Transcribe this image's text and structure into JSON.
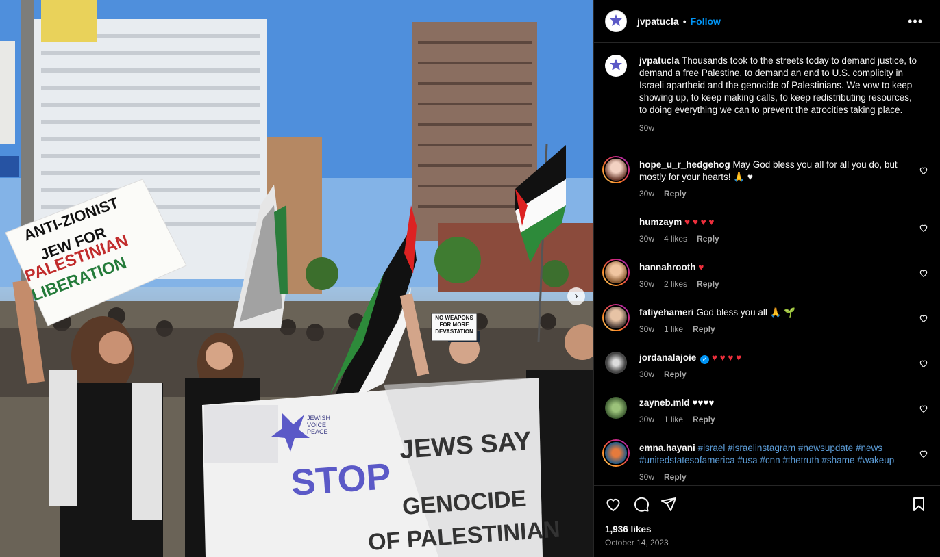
{
  "post": {
    "image_alt": "Protest march photo",
    "username": "jvpatucla",
    "follow_label": "Follow",
    "separator": "•",
    "more_label": "•••",
    "caption": "Thousands took to the streets today to demand justice, to demand a free Palestine, to demand an end to U.S. complicity in Israeli apartheid and the genocide of Palestinians. We vow to keep showing up, to keep making calls, to keep redistributing resources, to doing everything we can to prevent the atrocities taking place.",
    "caption_time": "30w",
    "likes": "1,936 likes",
    "date": "October 14, 2023",
    "next_label": "›"
  },
  "photo_text": {
    "sign1_line1": "ANTI-ZIONIST",
    "sign1_line2": "JEW FOR",
    "sign1_line3": "PALESTINIAN",
    "sign1_line4": "LIBERATION",
    "banner_line1": "JEWS SAY",
    "banner_stop": "STOP",
    "banner_line2": "GENOCIDE",
    "banner_line3": "OF PALESTINIAN",
    "banner_org": "JEWISH VOICE PEACE",
    "sign2": "NO WEAPONS FOR MORE DEVASTATION"
  },
  "comments": [
    {
      "user": "hope_u_r_hedgehog",
      "text": "May God bless you all for all you do, but mostly for your hearts! 🙏 ♥",
      "time": "30w",
      "likes": "",
      "reply": "Reply"
    },
    {
      "user": "humzaym",
      "text": "♥ ♥ ♥ ♥",
      "time": "30w",
      "likes": "4 likes",
      "reply": "Reply"
    },
    {
      "user": "hannahrooth",
      "text": "♥",
      "time": "30w",
      "likes": "2 likes",
      "reply": "Reply"
    },
    {
      "user": "fatiyehameri",
      "text": "God bless you all 🙏 🌱",
      "time": "30w",
      "likes": "1 like",
      "reply": "Reply"
    },
    {
      "user": "jordanalajoie",
      "text": "♥ ♥ ♥ ♥",
      "time": "30w",
      "likes": "",
      "reply": "Reply"
    },
    {
      "user": "zayneb.mld",
      "text": "♥♥♥♥",
      "time": "30w",
      "likes": "1 like",
      "reply": "Reply"
    },
    {
      "user": "emna.hayani",
      "text": "#israel #israelinstagram #newsupdate #news #unitedstatesofamerica #usa #cnn #thetruth #shame #wakeup",
      "time": "30w",
      "likes": "",
      "reply": "Reply"
    }
  ],
  "colors": {
    "follow": "#0095f6",
    "heart_red": "#ed2f3c",
    "secondary_text": "#a8a8a8",
    "hashtag": "#5b9bd5"
  },
  "icons": [
    "heart-icon",
    "comment-icon",
    "share-icon",
    "bookmark-icon",
    "more-icon",
    "verified-icon"
  ]
}
